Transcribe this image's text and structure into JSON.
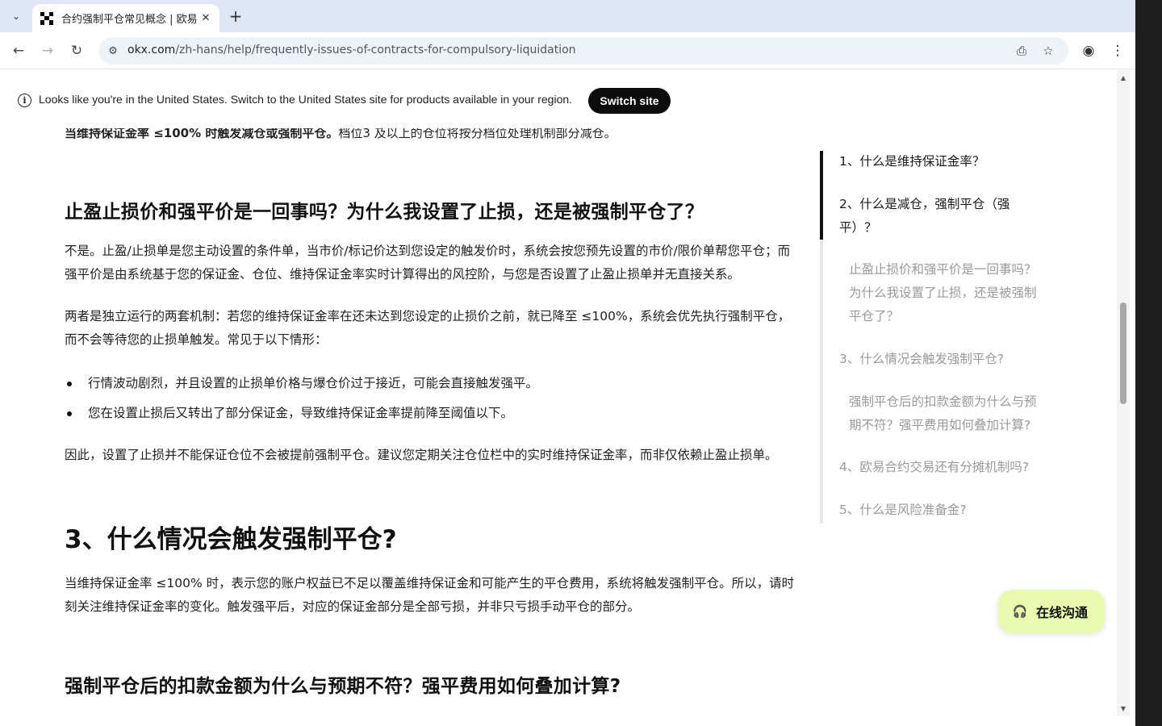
{
  "browser": {
    "tab_title": "合约强制平仓常见概念 | 欧易",
    "url_host": "okx.com",
    "url_path": "/zh-hans/help/frequently-issues-of-contracts-for-compulsory-liquidation"
  },
  "banner": {
    "text": "Looks like you're in the United States. Switch to the United States site for products available in your region.",
    "button": "Switch site"
  },
  "article": {
    "cut_line_bold": "当维持保证金率 ≤100% 时触发减仓或强制平仓。",
    "cut_line_rest": "档位3 及以上的仓位将按分档位处理机制部分减仓。",
    "h_stop": "止盈止损价和强平价是一回事吗？为什么我设置了止损，还是被强制平仓了？",
    "p1": "不是。止盈/止损单是您主动设置的条件单，当市价/标记价达到您设定的触发价时，系统会按您预先设置的市价/限价单帮您平仓；而强平价是由系统基于您的保证金、仓位、维持保证金率实时计算得出的风控阶，与您是否设置了止盈止损单并无直接关系。",
    "p2": "两者是独立运行的两套机制：若您的维持保证金率在还未达到您设定的止损价之前，就已降至 ≤100%，系统会优先执行强制平仓，而不会等待您的止损单触发。常见于以下情形：",
    "bullets": [
      "行情波动剧烈，并且设置的止损单价格与爆仓价过于接近，可能会直接触发强平。",
      "您在设置止损后又转出了部分保证金，导致维持保证金率提前降至阈值以下。"
    ],
    "p3": "因此，设置了止损并不能保证仓位不会被提前强制平仓。建议您定期关注仓位栏中的实时维持保证金率，而非仅依赖止盈止损单。",
    "h3": "3、什么情况会触发强制平仓?",
    "p4": "当维持保证金率 ≤100% 时，表示您的账户权益已不足以覆盖维持保证金和可能产生的平仓费用，系统将触发强制平仓。所以，请时刻关注维持保证金率的变化。触发强平后，对应的保证金部分是全部亏损，并非只亏损手动平仓的部分。",
    "h_fee": "强制平仓后的扣款金额为什么与预期不符？强平费用如何叠加计算?"
  },
  "toc": {
    "items": [
      "1、什么是维持保证金率？",
      "2、什么是减仓，强制平仓（强平）？",
      "止盈止损价和强平价是一回事吗？为什么我设置了止损，还是被强制平仓了？",
      "3、什么情况会触发强制平仓?",
      "强制平仓后的扣款金额为什么与预期不符？强平费用如何叠加计算?",
      "4、欧易合约交易还有分摊机制吗?",
      "5、什么是风险准备金?"
    ]
  },
  "chat": {
    "label": "在线沟通"
  }
}
